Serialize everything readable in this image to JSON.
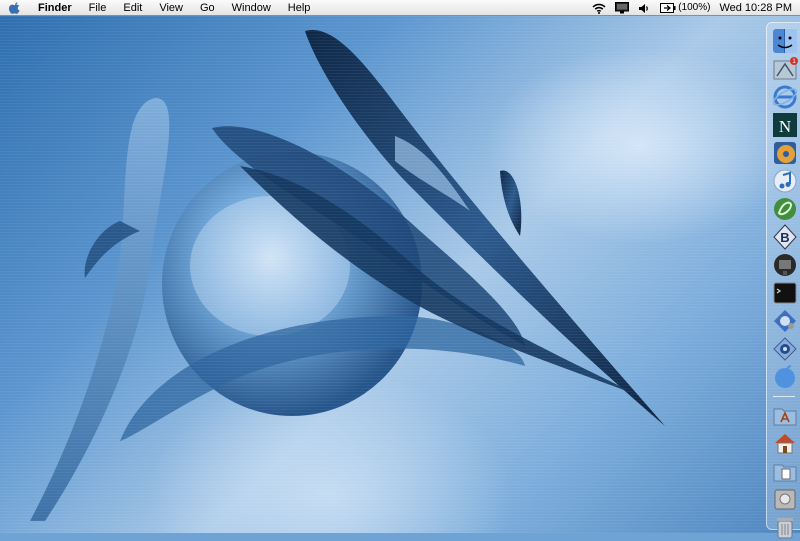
{
  "menubar": {
    "app_name": "Finder",
    "menus": [
      "File",
      "Edit",
      "View",
      "Go",
      "Window",
      "Help"
    ],
    "battery_text": "(100%)",
    "clock": "Wed 10:28 PM"
  },
  "dock": {
    "items": [
      {
        "name": "finder",
        "icon": "finder-icon"
      },
      {
        "name": "mail",
        "icon": "mail-icon"
      },
      {
        "name": "internet-explorer",
        "icon": "internet-explorer-icon"
      },
      {
        "name": "netscape",
        "icon": "netscape-icon"
      },
      {
        "name": "itunes-cd",
        "icon": "itunes-cd-icon"
      },
      {
        "name": "itunes",
        "icon": "itunes-icon"
      },
      {
        "name": "dreamweaver",
        "icon": "dreamweaver-icon"
      },
      {
        "name": "bbedit",
        "icon": "bbedit-icon"
      },
      {
        "name": "tv",
        "icon": "tv-icon"
      },
      {
        "name": "terminal",
        "icon": "terminal-icon"
      },
      {
        "name": "network-utility",
        "icon": "network-utility-icon"
      },
      {
        "name": "system-preferences",
        "icon": "system-preferences-icon"
      },
      {
        "name": "apple-help",
        "icon": "apple-help-icon"
      },
      {
        "name": "applications",
        "icon": "applications-folder-icon"
      },
      {
        "name": "home",
        "icon": "home-icon"
      },
      {
        "name": "documents",
        "icon": "documents-folder-icon"
      },
      {
        "name": "disk-utility",
        "icon": "disk-utility-icon"
      },
      {
        "name": "trash",
        "icon": "trash-icon"
      }
    ]
  },
  "colors": {
    "desktop_dark": "#2f6fb0",
    "desktop_light": "#a9c9e8",
    "glyph_navy": "#17325a"
  }
}
